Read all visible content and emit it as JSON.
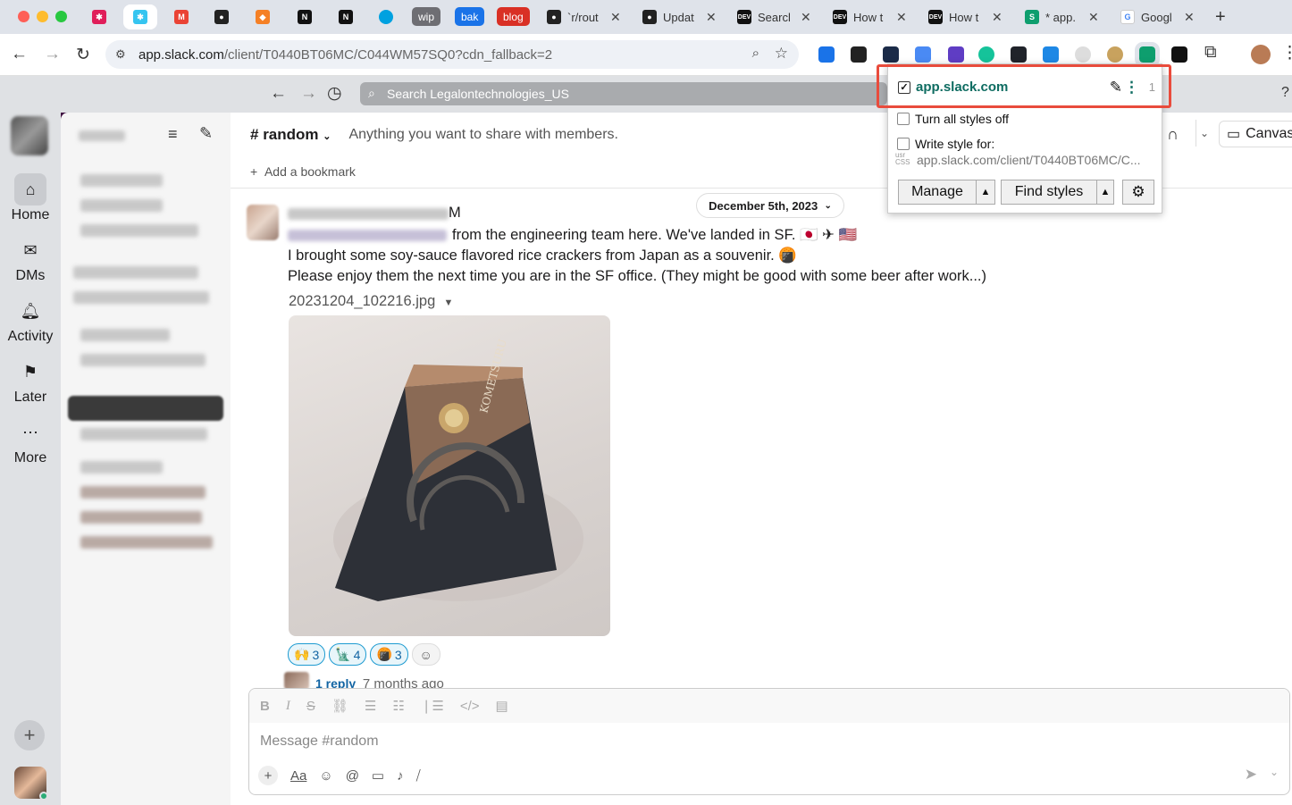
{
  "browser": {
    "tabs": [
      {
        "title": "`r/rout",
        "icon": "github-icon"
      },
      {
        "title": "Updat",
        "icon": "github-icon"
      },
      {
        "title": "Searcl",
        "icon": "dev-icon"
      },
      {
        "title": "How t",
        "icon": "dev-icon"
      },
      {
        "title": "How t",
        "icon": "dev-icon"
      },
      {
        "title": "* app.",
        "icon": "stylus-icon"
      },
      {
        "title": "Googl",
        "icon": "google-icon"
      }
    ],
    "pills": [
      "wip",
      "bak",
      "blog"
    ],
    "url_host": "app.slack.com",
    "url_path": "/client/T0440BT06MC/C044WM57SQ0?cdn_fallback=2"
  },
  "slack": {
    "search_placeholder": "Search Legalontechnologies_US",
    "rail": [
      {
        "label": "Home",
        "icon": "home-icon"
      },
      {
        "label": "DMs",
        "icon": "dms-icon"
      },
      {
        "label": "Activity",
        "icon": "bell-icon"
      },
      {
        "label": "Later",
        "icon": "bookmark-icon"
      },
      {
        "label": "More",
        "icon": "more-icon"
      }
    ],
    "channel": {
      "name": "random",
      "topic": "Anything you want to share with members.",
      "add_bookmark": "Add a bookmark",
      "canvas": "Canvas"
    },
    "date_divider": "December 5th, 2023",
    "message": {
      "sender_suffix": "M",
      "line1": "from the engineering team here. We've landed in SF.",
      "line2": "I brought some soy-sauce flavored rice crackers from Japan as a souvenir.",
      "line3": "Please enjoy them the next time you are in the SF office. (They might be good with some beer after work...)",
      "file_name": "20231204_102216.jpg",
      "reactions": [
        {
          "emoji": "🙌",
          "count": "3"
        },
        {
          "emoji": "🗽",
          "count": "4"
        },
        {
          "emoji": "🍘",
          "count": "3"
        }
      ],
      "replies": "1 reply",
      "reply_time": "7 months ago"
    },
    "composer_placeholder": "Message #random"
  },
  "stylus_popup": {
    "site": "app.slack.com",
    "count": "1",
    "turn_off": "Turn all styles off",
    "write_for": "Write style for:",
    "write_url": "app.slack.com/client/T0440BT06MC/C...",
    "manage": "Manage",
    "find_styles": "Find styles"
  }
}
